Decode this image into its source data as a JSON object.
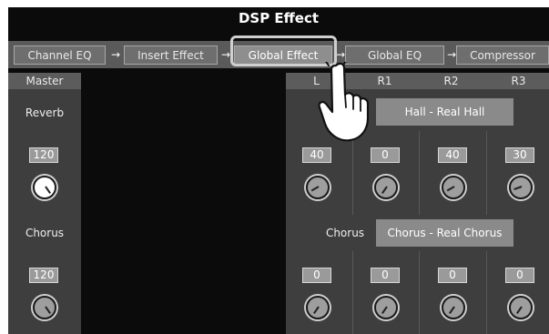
{
  "window": {
    "title": "DSP Effect"
  },
  "tabs": [
    {
      "label": "Channel EQ"
    },
    {
      "label": "Insert Effect"
    },
    {
      "label": "Global Effect",
      "active": true
    },
    {
      "label": "Global EQ"
    },
    {
      "label": "Compressor"
    }
  ],
  "master": {
    "header": "Master",
    "reverb_label": "Reverb",
    "reverb_value": "120",
    "chorus_label": "Chorus",
    "chorus_value": "120"
  },
  "columns": {
    "headers": [
      "L",
      "R1",
      "R2",
      "R3"
    ]
  },
  "reverb": {
    "type_value": "Hall - Real Hall",
    "values": [
      "40",
      "0",
      "40",
      "30"
    ]
  },
  "chorus": {
    "label": "Chorus",
    "type_value": "Chorus - Real Chorus",
    "values": [
      "0",
      "0",
      "0",
      "0"
    ]
  },
  "icons": {
    "tab_arrow": "right-arrow-icon",
    "knob": "knob-icon",
    "pointer": "pointing-hand-icon"
  }
}
